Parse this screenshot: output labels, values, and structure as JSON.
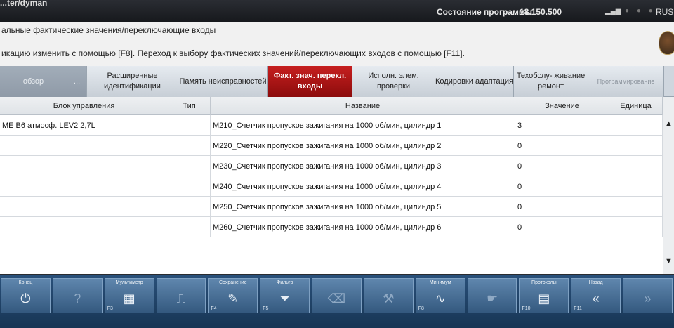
{
  "topbar": {
    "app_title": "...ter/dyman",
    "status_label": "Состояние программы",
    "version": "18.150.500",
    "lang": "RUS"
  },
  "info": {
    "line1": "альные фактические значения/переключающие входы",
    "line2": "икацию изменить с помощью [F8]. Переход к выбору фактических значений/переключающих входов с помощью [F11]."
  },
  "tabs": [
    {
      "label": "обзор",
      "state": "dim"
    },
    {
      "label": "...",
      "state": "dim"
    },
    {
      "label": "Расширенные идентификации",
      "state": "normal"
    },
    {
      "label": "Память неисправностей",
      "state": "normal"
    },
    {
      "label": "Факт. знач. перекл. входы",
      "state": "active"
    },
    {
      "label": "Исполн. элем. проверки",
      "state": "normal"
    },
    {
      "label": "Кодировки адаптация",
      "state": "normal"
    },
    {
      "label": "Техобслу- живание ремонт",
      "state": "normal"
    },
    {
      "label": "Программирование",
      "state": "greyed"
    }
  ],
  "table": {
    "columns": [
      "Блок управления",
      "Тип",
      "Название",
      "Значение",
      "Единица"
    ],
    "rows": [
      {
        "unit": "ME B6 атмосф. LEV2 2,7L",
        "type": "",
        "name": "M210_Счетчик пропусков зажигания на 1000 об/мин, цилиндр 1",
        "value": "3",
        "measure": ""
      },
      {
        "unit": "",
        "type": "",
        "name": "M220_Счетчик пропусков зажигания на 1000 об/мин, цилиндр 2",
        "value": "0",
        "measure": ""
      },
      {
        "unit": "",
        "type": "",
        "name": "M230_Счетчик пропусков зажигания на 1000 об/мин, цилиндр 3",
        "value": "0",
        "measure": ""
      },
      {
        "unit": "",
        "type": "",
        "name": "M240_Счетчик пропусков зажигания на 1000 об/мин, цилиндр 4",
        "value": "0",
        "measure": ""
      },
      {
        "unit": "",
        "type": "",
        "name": "M250_Счетчик пропусков зажигания на 1000 об/мин, цилиндр 5",
        "value": "0",
        "measure": ""
      },
      {
        "unit": "",
        "type": "",
        "name": "M260_Счетчик пропусков зажигания на 1000 об/мин, цилиндр 6",
        "value": "0",
        "measure": ""
      }
    ]
  },
  "toolbar": [
    {
      "label": "Конец",
      "icon": "power-icon",
      "glyph": "⏻",
      "fkey": "",
      "dim": false
    },
    {
      "label": "",
      "icon": "help-icon",
      "glyph": "?",
      "fkey": "",
      "dim": true
    },
    {
      "label": "Мультиметр",
      "icon": "multimeter-icon",
      "glyph": "▦",
      "fkey": "F3",
      "dim": false
    },
    {
      "label": "",
      "icon": "oscilloscope-icon",
      "glyph": "⎍",
      "fkey": "",
      "dim": true
    },
    {
      "label": "Сохранение",
      "icon": "save-icon",
      "glyph": "✎",
      "fkey": "F4",
      "dim": false
    },
    {
      "label": "Фильтр",
      "icon": "filter-icon",
      "glyph": "⏷",
      "fkey": "F5",
      "dim": false
    },
    {
      "label": "",
      "icon": "trash-icon",
      "glyph": "⌫",
      "fkey": "",
      "dim": true
    },
    {
      "label": "",
      "icon": "tools-icon",
      "glyph": "⚒",
      "fkey": "",
      "dim": true
    },
    {
      "label": "Минимум",
      "icon": "minimum-icon",
      "glyph": "∿",
      "fkey": "F8",
      "dim": false
    },
    {
      "label": "",
      "icon": "hand-icon",
      "glyph": "☛",
      "fkey": "",
      "dim": true
    },
    {
      "label": "Протоколы",
      "icon": "protocol-icon",
      "glyph": "▤",
      "fkey": "F10",
      "dim": false
    },
    {
      "label": "Назад",
      "icon": "back-icon",
      "glyph": "«",
      "fkey": "F11",
      "dim": false
    },
    {
      "label": "",
      "icon": "forward-icon",
      "glyph": "»",
      "fkey": "",
      "dim": true
    }
  ]
}
